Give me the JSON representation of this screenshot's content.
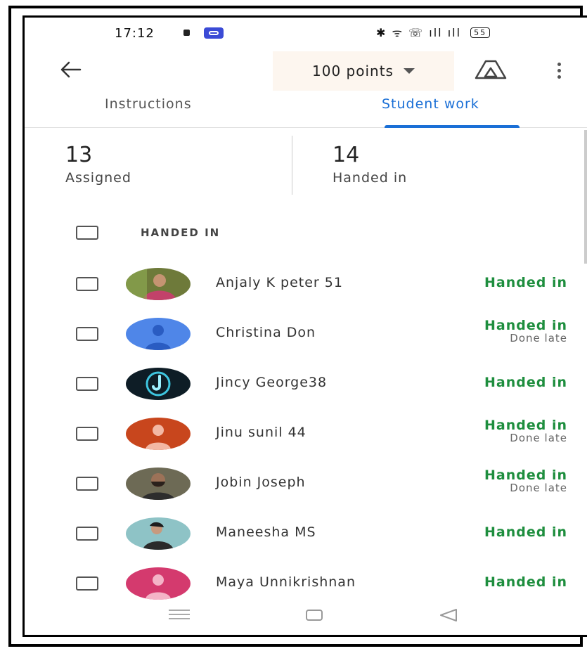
{
  "status_bar": {
    "time": "17:12",
    "right_icons": "✱ ᯤ ☏ ıll ıll",
    "battery": "55"
  },
  "app_bar": {
    "points_label": "100 points",
    "icons": [
      "arrow-back-icon",
      "drive-icon",
      "more-vert-icon"
    ]
  },
  "tabs": [
    {
      "label": "Instructions",
      "active": false
    },
    {
      "label": "Student work",
      "active": true
    }
  ],
  "stats": {
    "assigned": {
      "value": "13",
      "label": "Assigned"
    },
    "handed_in": {
      "value": "14",
      "label": "Handed in"
    }
  },
  "section": {
    "label": "HANDED IN"
  },
  "students": [
    {
      "name": "Anjaly K peter 51",
      "status": "Handed in",
      "note": "",
      "avatar_color": "#7a6b3e"
    },
    {
      "name": "Christina Don",
      "status": "Handed in",
      "note": "Done late",
      "avatar_color": "#4f86e8"
    },
    {
      "name": "Jincy George38",
      "status": "Handed in",
      "note": "",
      "avatar_color": "#0e1d26"
    },
    {
      "name": "Jinu sunil 44",
      "status": "Handed in",
      "note": "Done late",
      "avatar_color": "#c8461d"
    },
    {
      "name": "Jobin Joseph",
      "status": "Handed in",
      "note": "Done late",
      "avatar_color": "#3a3a2e"
    },
    {
      "name": "Maneesha MS",
      "status": "Handed in",
      "note": "",
      "avatar_color": "#4f8f96"
    },
    {
      "name": "Maya Unnikrishnan",
      "status": "Handed in",
      "note": "",
      "avatar_color": "#d43a6e"
    }
  ],
  "colors": {
    "accent": "#1a6fd6",
    "handed_in": "#1e8e3e"
  }
}
